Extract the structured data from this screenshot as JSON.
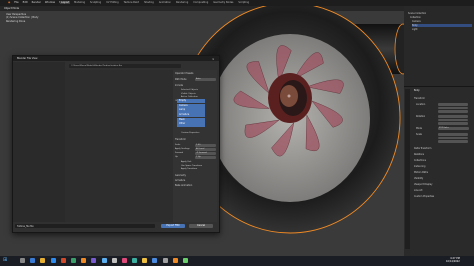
{
  "menu": [
    "File",
    "Edit",
    "Render",
    "Window",
    "Help"
  ],
  "workspace_tabs": [
    {
      "label": "Layout",
      "active": true
    },
    {
      "label": "Modeling",
      "active": false
    },
    {
      "label": "Sculpting",
      "active": false
    },
    {
      "label": "UV Editing",
      "active": false
    },
    {
      "label": "Texture Paint",
      "active": false
    },
    {
      "label": "Shading",
      "active": false
    },
    {
      "label": "Animation",
      "active": false
    },
    {
      "label": "Rendering",
      "active": false
    },
    {
      "label": "Compositing",
      "active": false
    },
    {
      "label": "Geometry Nodes",
      "active": false
    },
    {
      "label": "Scripting",
      "active": false
    }
  ],
  "viewport": {
    "overlay_lines": [
      "User Perspective",
      "(1) Scene Collection | Body",
      "Rendering Done"
    ],
    "mode": "Object Mode"
  },
  "dialog": {
    "title": "Blender File View",
    "path": "C:\\Users\\Marco\\Models\\Blender\\Turbine\\turbine.fbx",
    "filename": "Turbine_fbx.fbx",
    "confirm_label": "Export FBX",
    "cancel_label": "Cancel",
    "options": {
      "header": "Operator Presets",
      "path_mode_label": "Path Mode",
      "path_mode_value": "Auto",
      "include_label": "Include",
      "limit_to": [
        "Selected Objects",
        "Visible Objects",
        "Active Collection"
      ],
      "object_types_label": "Object Types",
      "object_types": [
        "Empty",
        "Camera",
        "Lamp",
        "Armature",
        "Mesh",
        "Other"
      ],
      "custom_properties": "Custom Properties",
      "transform_label": "Transform",
      "scale_label": "Scale",
      "scale_value": "1.00",
      "apply_scalings_label": "Apply Scalings",
      "apply_scalings_value": "All Local",
      "forward_label": "Forward",
      "forward_value": "-Z Forward",
      "up_label": "Up",
      "up_value": "Y Up",
      "apply_unit": "Apply Unit",
      "use_space_transform": "Use Space Transform",
      "apply_transform": "Apply Transform",
      "geometry": "Geometry",
      "armature": "Armature",
      "bake_animation": "Bake Animation"
    }
  },
  "outliner": {
    "items": [
      "Scene Collection",
      "Collection",
      "Camera",
      "Body",
      "Light"
    ]
  },
  "properties": {
    "object_name": "Body",
    "sections": [
      "Transform",
      "Location",
      "Rotation",
      "Mode",
      "Scale",
      "Delta Transform",
      "Relations",
      "Collections",
      "Instancing",
      "Motion Paths",
      "Visibility",
      "Viewport Display",
      "Line Art",
      "Custom Properties"
    ],
    "rotation_mode": "XYZ Euler"
  },
  "taskbar": {
    "time": "4:27 PM",
    "date": "10/14/2022"
  },
  "colors": {
    "accent": "#4772b3",
    "selection_orange": "#f08a24",
    "confirm_blue": "#4772b3"
  }
}
